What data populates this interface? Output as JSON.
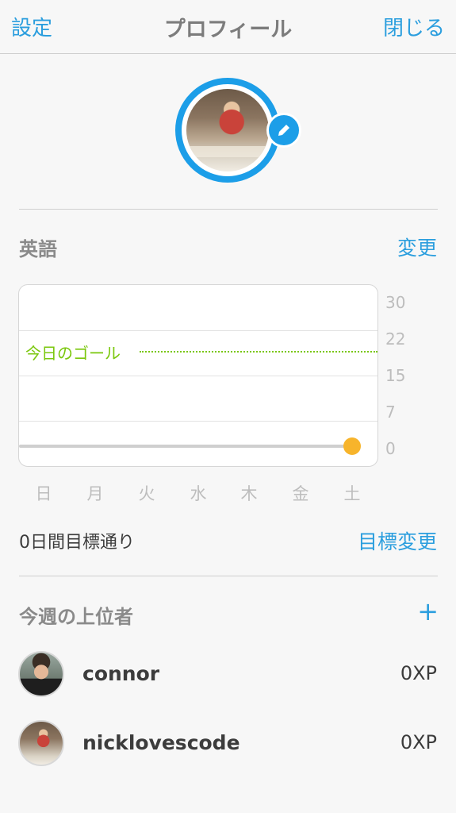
{
  "nav": {
    "left": "設定",
    "title": "プロフィール",
    "right": "閉じる"
  },
  "language": {
    "title": "英語",
    "change": "変更"
  },
  "chart_data": {
    "type": "line",
    "y_ticks": [
      "30",
      "22",
      "15",
      "7",
      "0"
    ],
    "ylim": [
      0,
      30
    ],
    "categories": [
      "日",
      "月",
      "火",
      "水",
      "木",
      "金",
      "土"
    ],
    "values": [
      0,
      0,
      0,
      0,
      0,
      0,
      0
    ],
    "goal_label": "今日のゴール",
    "goal_value": 20,
    "colors": {
      "goal": "#7ac70c",
      "point": "#f7b42b",
      "line": "#cfcfcf"
    }
  },
  "goal": {
    "streak_text": "0日間目標通り",
    "change_goal": "目標変更"
  },
  "leaders": {
    "title": "今週の上位者",
    "add": "+",
    "rows": [
      {
        "name": "connor",
        "xp": "0XP"
      },
      {
        "name": "nicklovescode",
        "xp": "0XP"
      }
    ]
  },
  "colors": {
    "accent": "#2b9ede",
    "ring": "#1c9ee8"
  }
}
